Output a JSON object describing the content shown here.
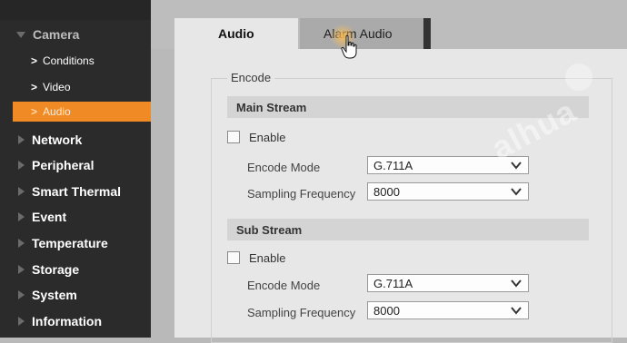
{
  "sidebar": {
    "camera_label": "Camera",
    "camera_children": [
      {
        "label": "Conditions"
      },
      {
        "label": "Video"
      },
      {
        "label": "Audio"
      }
    ],
    "items": [
      {
        "label": "Network"
      },
      {
        "label": "Peripheral"
      },
      {
        "label": "Smart Thermal"
      },
      {
        "label": "Event"
      },
      {
        "label": "Temperature"
      },
      {
        "label": "Storage"
      },
      {
        "label": "System"
      },
      {
        "label": "Information"
      }
    ]
  },
  "tabs": {
    "audio": "Audio",
    "alarm_audio": "Alarm Audio"
  },
  "encode": {
    "legend": "Encode",
    "main_stream": {
      "title": "Main Stream",
      "enable_label": "Enable",
      "encode_mode_label": "Encode Mode",
      "encode_mode_value": "G.711A",
      "sampling_label": "Sampling Frequency",
      "sampling_value": "8000"
    },
    "sub_stream": {
      "title": "Sub Stream",
      "enable_label": "Enable",
      "encode_mode_label": "Encode Mode",
      "encode_mode_value": "G.711A",
      "sampling_label": "Sampling Frequency",
      "sampling_value": "8000"
    }
  },
  "watermark": "alhua",
  "colors": {
    "sidebar_bg": "#2b2b2b",
    "active_item": "#f08a24",
    "panel_bg": "#e7e7e7",
    "tab_inactive": "#aaaaaa"
  }
}
